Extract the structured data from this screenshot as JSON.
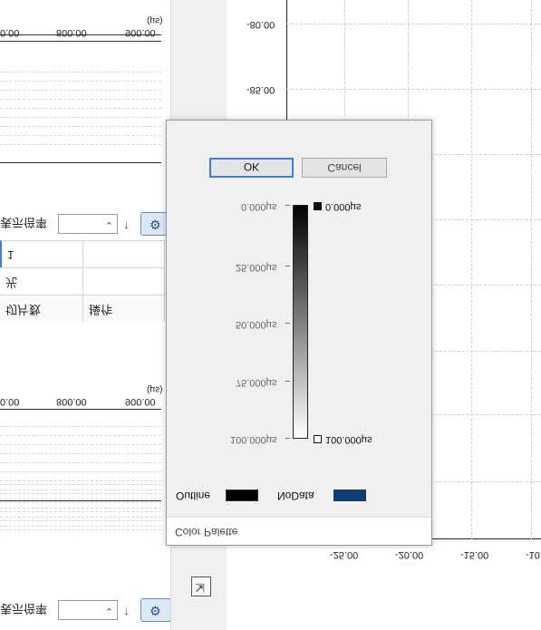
{
  "left_panel": {
    "top_chart": {
      "x_tick_labels": [
        "0.00",
        "800.00",
        "900.00"
      ],
      "unit": "(µs)"
    },
    "bottom_chart": {
      "x_tick_labels": [
        "0.00",
        "800.00",
        "900.00"
      ],
      "unit": "(µs)"
    },
    "control_label": "表示倍率",
    "param_table": {
      "headers": [
        "切片数",
        "操作"
      ],
      "rows": [
        [
          "光",
          ""
        ],
        [
          "1",
          ""
        ]
      ]
    }
  },
  "main_chart": {
    "y_tick_labels": [
      "-80.00",
      "-85.00"
    ],
    "x_tick_labels": [
      "-25.00",
      "-20.00",
      "-15.00",
      "-10"
    ]
  },
  "dialog": {
    "title": "Color Palette",
    "outline_label": "Outline",
    "outline_color": "#000000",
    "nodata_label": "NoData",
    "nodata_color": "#0b3d7a",
    "gradient": {
      "start_color": "#000000",
      "end_color": "#ffffff",
      "top_stop_value": "0.000µs",
      "bottom_stop_value": "100.000µs",
      "scale_labels": [
        "0.000µs",
        "25.000µs",
        "50.000µs",
        "75.000µs",
        "100.000µs"
      ]
    },
    "ok_label": "OK",
    "cancel_label": "Cancel"
  }
}
